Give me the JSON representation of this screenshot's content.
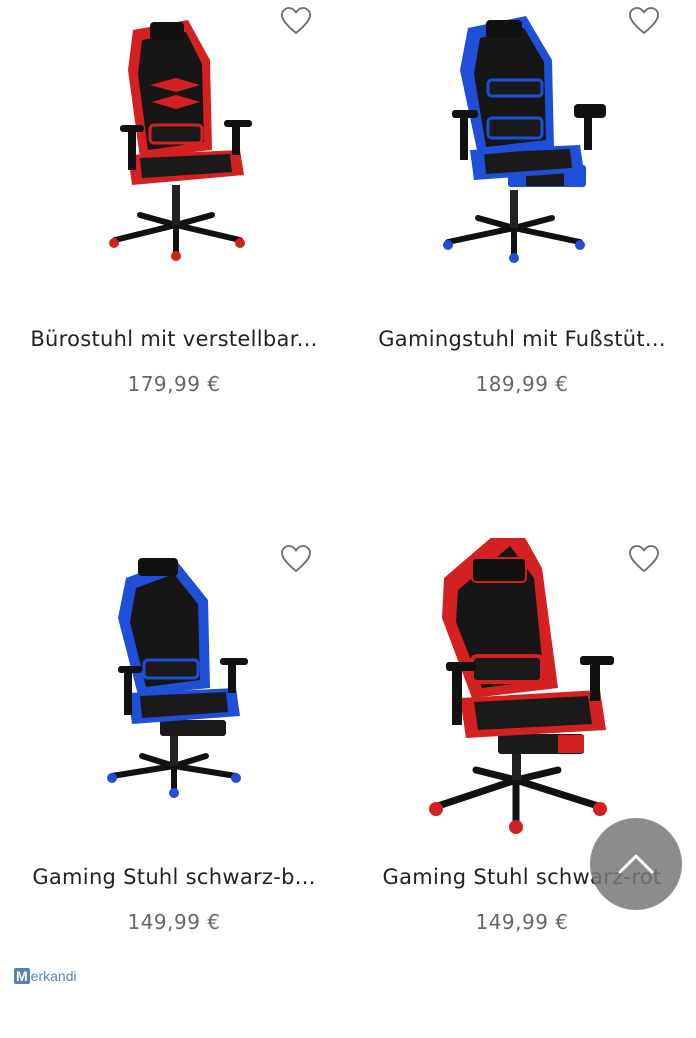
{
  "products": [
    {
      "title": "Bürostuhl mit verstellbar...",
      "price": "179,99 €",
      "accent": "#d42020",
      "image": "red-black-gaming-chair"
    },
    {
      "title": "Gamingstuhl mit Fußstüt...",
      "price": "189,99 €",
      "accent": "#1f4fd8",
      "image": "blue-black-gaming-chair-with-footrest"
    },
    {
      "title": "Gaming Stuhl schwarz-b...",
      "price": "149,99 €",
      "accent": "#1f4fd8",
      "image": "blue-black-gaming-chair"
    },
    {
      "title": "Gaming Stuhl schwarz-rot",
      "price": "149,99 €",
      "accent": "#d42020",
      "image": "red-black-gaming-chair-with-footrest"
    }
  ],
  "icons": {
    "favorite": "heart-outline-icon",
    "scroll_top": "chevron-up-icon"
  },
  "watermark": {
    "logo_text": "Merkandi"
  }
}
